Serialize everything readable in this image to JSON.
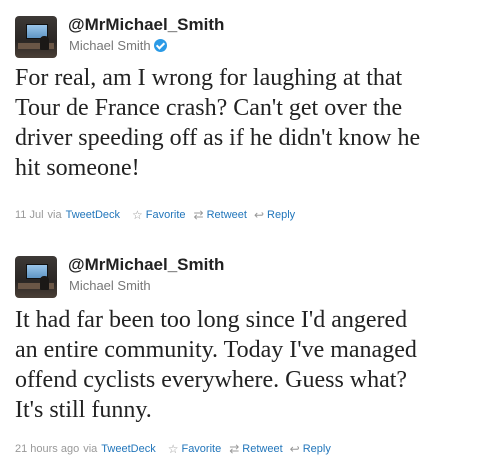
{
  "tweets": [
    {
      "handle": "@MrMichael_Smith",
      "display_name": "Michael Smith",
      "verified": true,
      "text_lines": [
        "For real, am I wrong for laughing at that",
        "Tour de France crash? Can't get over the",
        "driver speeding off as if he didn't know he",
        "hit someone!"
      ],
      "timestamp": "11 Jul",
      "via_label": "via",
      "client": "TweetDeck",
      "actions": {
        "favorite": "Favorite",
        "retweet": "Retweet",
        "reply": "Reply"
      }
    },
    {
      "handle": "@MrMichael_Smith",
      "display_name": "Michael Smith",
      "verified": false,
      "text_lines": [
        "It had far been too long since I'd angered",
        "an entire community. Today I've managed",
        "offend cyclists everywhere. Guess what?",
        "It's still funny."
      ],
      "timestamp": "21 hours ago",
      "via_label": "via",
      "client": "TweetDeck",
      "actions": {
        "favorite": "Favorite",
        "retweet": "Retweet",
        "reply": "Reply"
      }
    }
  ],
  "icons": {
    "favorite": "star-icon",
    "retweet": "retweet-icon",
    "reply": "reply-icon",
    "verified": "verified-badge-icon"
  },
  "colors": {
    "link": "#2276bb",
    "verified": "#2b9ae6",
    "meta": "#999999"
  }
}
